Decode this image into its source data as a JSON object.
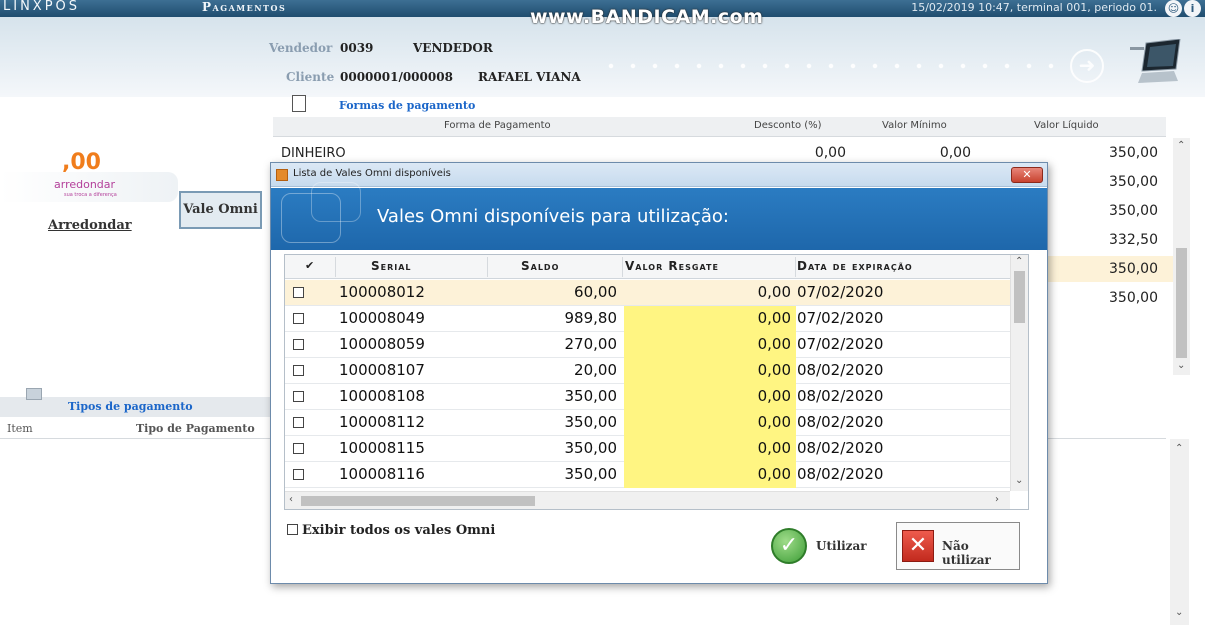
{
  "app": {
    "logo": "LINXPOS",
    "title": "Pagamentos",
    "status": "15/02/2019 10:47, terminal 001, periodo 01.",
    "watermark": "www.BANDICAM.com"
  },
  "header": {
    "vendedor_label": "Vendedor",
    "vendedor_code": "0039",
    "vendedor_name": "VENDEDOR",
    "cliente_label": "Cliente",
    "cliente_code": "0000001/000008",
    "cliente_name": "RAFAEL VIANA"
  },
  "left_panel": {
    "round_value": ",00",
    "round_brand": "arredondar",
    "round_tagline": "sua troca a diferença",
    "round_label": "Arredondar",
    "vale_omni_button": "Vale Omni"
  },
  "formas": {
    "title": "Formas de pagamento",
    "columns": [
      "Forma de Pagamento",
      "Desconto (%)",
      "Valor Mínimo",
      "Valor Líquido"
    ],
    "first_row": {
      "forma": "DINHEIRO",
      "desconto": "0,00",
      "minimo": "0,00"
    },
    "liquid_values": [
      "350,00",
      "350,00",
      "350,00",
      "332,50",
      "350,00",
      "350,00"
    ]
  },
  "tipos": {
    "title": "Tipos de pagamento",
    "columns": [
      "Item",
      "Tipo de Pagamento"
    ]
  },
  "modal": {
    "title": "Lista de Vales Omni disponíveis",
    "close_label": "✕",
    "banner": "Vales Omni disponíveis para utilização:",
    "columns": {
      "check": "✔",
      "serial": "Serial",
      "saldo": "Saldo",
      "resgate": "Valor Resgate",
      "expiracao": "Data de expiração"
    },
    "rows": [
      {
        "serial": "100008012",
        "saldo": "60,00",
        "resgate": "0,00",
        "data": "07/02/2020"
      },
      {
        "serial": "100008049",
        "saldo": "989,80",
        "resgate": "0,00",
        "data": "07/02/2020"
      },
      {
        "serial": "100008059",
        "saldo": "270,00",
        "resgate": "0,00",
        "data": "07/02/2020"
      },
      {
        "serial": "100008107",
        "saldo": "20,00",
        "resgate": "0,00",
        "data": "08/02/2020"
      },
      {
        "serial": "100008108",
        "saldo": "350,00",
        "resgate": "0,00",
        "data": "08/02/2020"
      },
      {
        "serial": "100008112",
        "saldo": "350,00",
        "resgate": "0,00",
        "data": "08/02/2020"
      },
      {
        "serial": "100008115",
        "saldo": "350,00",
        "resgate": "0,00",
        "data": "08/02/2020"
      },
      {
        "serial": "100008116",
        "saldo": "350,00",
        "resgate": "0,00",
        "data": "08/02/2020"
      }
    ],
    "show_all_label": "Exibir todos os vales Omni",
    "use_button": "Utilizar",
    "no_use_button": "Não utilizar"
  },
  "colors": {
    "accent_blue": "#1e67ab",
    "highlight_yellow": "#fff582",
    "selected_row": "#fdf2d8",
    "brand_orange": "#f07d1c"
  }
}
